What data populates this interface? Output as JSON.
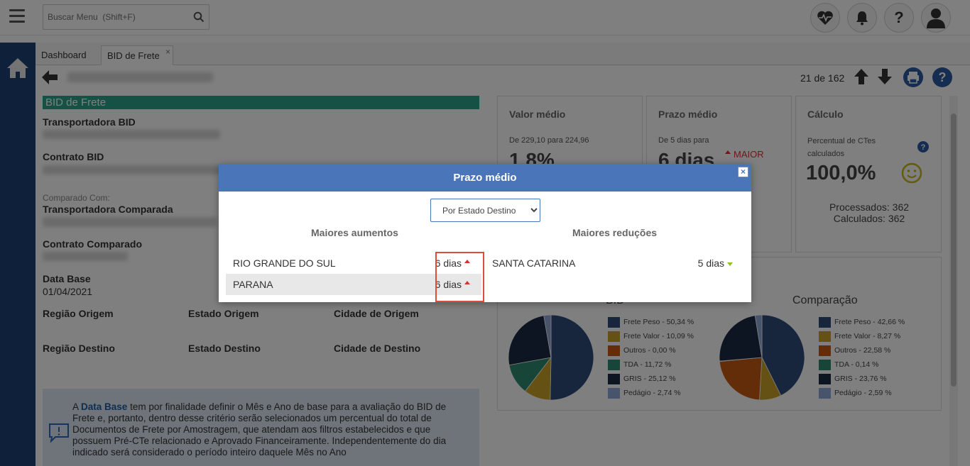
{
  "topbar": {
    "search_placeholder": "Buscar Menu  (Shift+F)",
    "icons": [
      "menu-icon",
      "search-icon",
      "heartbeat-icon",
      "bell-icon",
      "help-icon",
      "user-icon"
    ]
  },
  "tabs": [
    {
      "label": "Dashboard"
    },
    {
      "label": "BID de Frete",
      "close": "×"
    }
  ],
  "toolbar": {
    "counter": "21 de 162"
  },
  "form": {
    "section_title": "BID de Frete",
    "transportadora_bid_label": "Transportadora BID",
    "contrato_bid_label": "Contrato BID",
    "comparado_com_label": "Comparado Com:",
    "transportadora_comparada_label": "Transportadora Comparada",
    "contrato_comparado_label": "Contrato Comparado",
    "data_base_label": "Data Base",
    "data_base_value": "01/04/2021",
    "regiao_origem_label": "Região Origem",
    "estado_origem_label": "Estado Origem",
    "cidade_origem_label": "Cidade de Origem",
    "regiao_destino_label": "Região Destino",
    "estado_destino_label": "Estado Destino",
    "cidade_destino_label": "Cidade de Destino",
    "info_pre": "A ",
    "info_bold": "Data Base",
    "info_post": " tem por finalidade definir o Mês e Ano de base para a avaliação do BID de Frete e, portanto, dentro desse critério serão selecionados um percentual do total de Documentos de Frete por Amostragem, que atendam aos filtros estabelecidos e que possuem Pré-CTe relacionado e Aprovado Financeiramente. Independentemente do dia indicado será considerado o período inteiro daquele Mês no Ano"
  },
  "cards": {
    "valor_medio": {
      "title": "Valor médio",
      "sub": "De 229,10 para 224,96",
      "big": "1,8%"
    },
    "prazo_medio": {
      "title": "Prazo médio",
      "sub": "De 5 dias para",
      "big": "6 dias",
      "badge": "MAIOR"
    },
    "calculo": {
      "title": "Cálculo",
      "sub": "Percentual de CTes calculados",
      "big": "100,0%",
      "processados": "Processados: 362",
      "calculados": "Calculados: 362"
    }
  },
  "charts_panel": {
    "bid_title": "BID",
    "comparacao_title": "Comparação"
  },
  "chart_data": [
    {
      "type": "pie",
      "title": "BID",
      "labels": [
        "Frete Peso",
        "Frete Valor",
        "Outros",
        "TDA",
        "GRIS",
        "Pedágio"
      ],
      "values": [
        50.34,
        10.09,
        0.0,
        11.72,
        25.12,
        2.74
      ],
      "legend": [
        "Frete Peso - 50,34 %",
        "Frete Valor - 10,09 %",
        "Outros - 0,00 %",
        "TDA - 11,72 %",
        "GRIS - 25,12 %",
        "Pedágio - 2,74 %"
      ],
      "colors": [
        "#2e4a7a",
        "#c9a227",
        "#c55a11",
        "#2f8a70",
        "#1b2a44",
        "#8fa9d6"
      ]
    },
    {
      "type": "pie",
      "title": "Comparação",
      "labels": [
        "Frete Peso",
        "Frete Valor",
        "Outros",
        "TDA",
        "GRIS",
        "Pedágio"
      ],
      "values": [
        42.66,
        8.27,
        22.58,
        0.14,
        23.76,
        2.59
      ],
      "legend": [
        "Frete Peso - 42,66 %",
        "Frete Valor - 8,27 %",
        "Outros - 22,58 %",
        "TDA - 0,14 %",
        "GRIS - 23,76 %",
        "Pedágio - 2,59 %"
      ],
      "colors": [
        "#2e4a7a",
        "#c9a227",
        "#c55a11",
        "#2f8a70",
        "#1b2a44",
        "#8fa9d6"
      ]
    }
  ],
  "modal": {
    "title": "Prazo médio",
    "close": "×",
    "select_value": "Por Estado Destino",
    "aumentos_title": "Maiores aumentos",
    "reducoes_title": "Maiores reduções",
    "aumentos": [
      {
        "name": "RIO GRANDE DO SUL",
        "value": "6 dias"
      },
      {
        "name": "PARANA",
        "value": "6 dias"
      }
    ],
    "reducoes": [
      {
        "name": "SANTA CATARINA",
        "value": "5 dias"
      }
    ]
  }
}
